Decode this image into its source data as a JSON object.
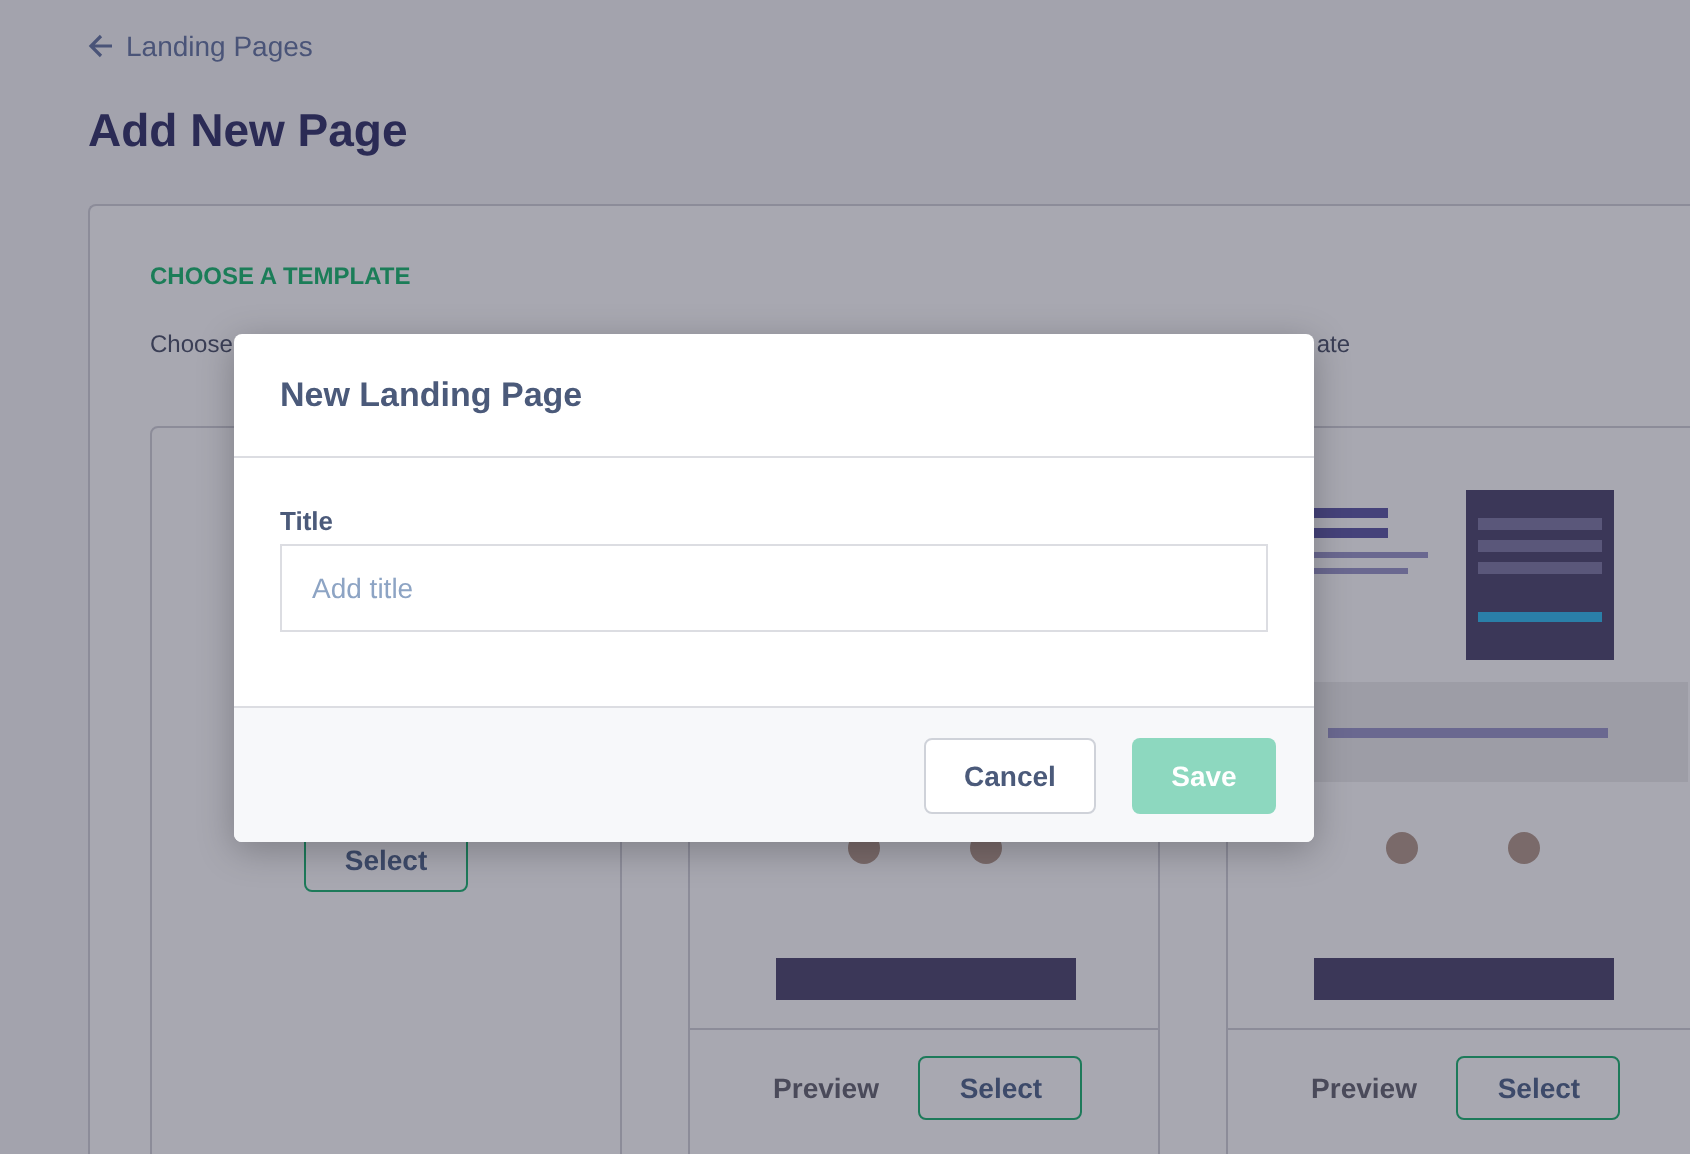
{
  "breadcrumb": {
    "label": "Landing Pages"
  },
  "page_title": "Add New Page",
  "section": {
    "heading": "CHOOSE A TEMPLATE",
    "subtitle_start": "Choose",
    "subtitle_end": "ate"
  },
  "templates": [
    {
      "kind": "blank",
      "select_label": "Select"
    },
    {
      "kind": "preview",
      "preview_label": "Preview",
      "select_label": "Select"
    },
    {
      "kind": "preview",
      "preview_label": "Preview",
      "select_label": "Select"
    }
  ],
  "modal": {
    "title": "New Landing Page",
    "field": {
      "label": "Title",
      "placeholder": "Add title"
    },
    "buttons": [
      {
        "label": "Cancel",
        "kind": "secondary",
        "disabled": false
      },
      {
        "label": "Save",
        "kind": "primary",
        "disabled": true
      }
    ]
  }
}
